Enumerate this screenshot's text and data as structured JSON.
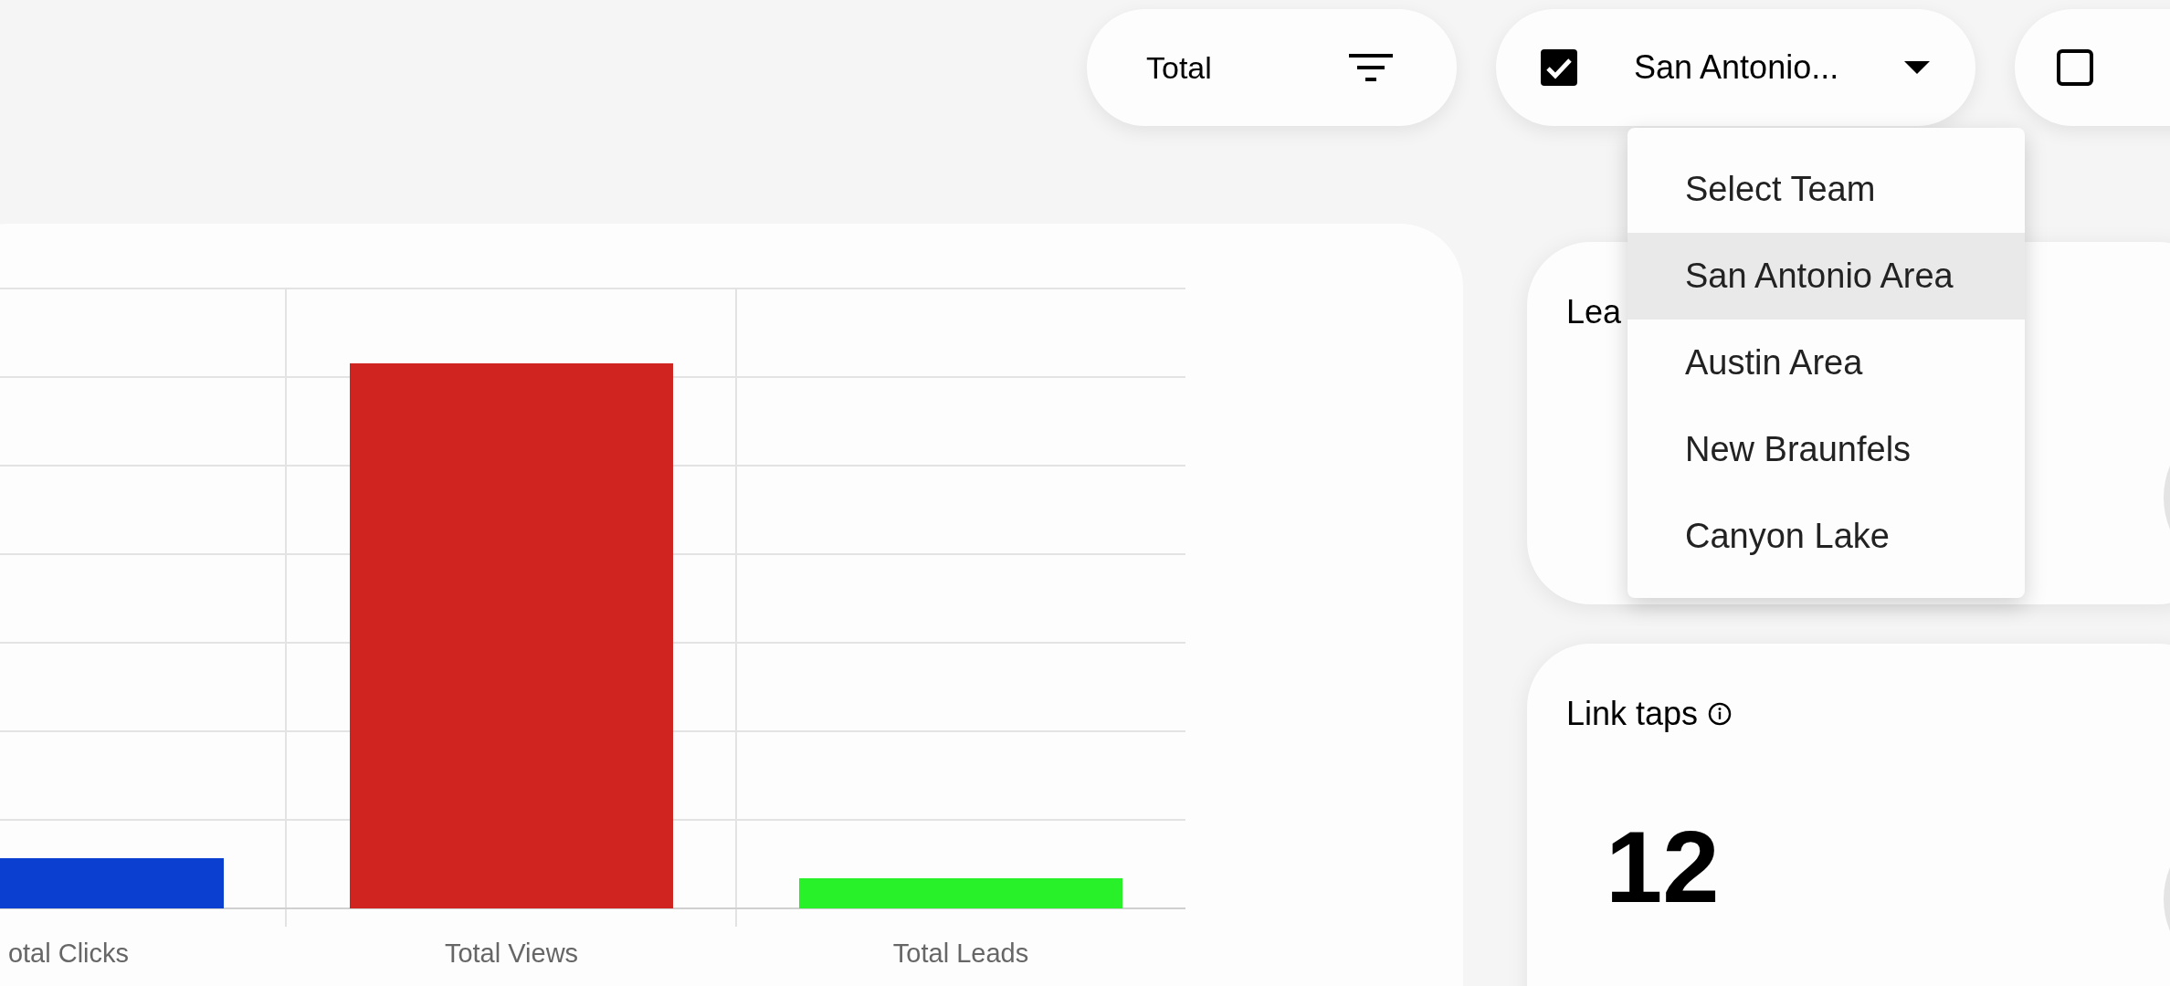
{
  "toolbar": {
    "metric_filter": {
      "label": "Total"
    },
    "team_filter": {
      "checked": true,
      "label": "San Antonio..."
    },
    "third_filter": {
      "checked": false
    }
  },
  "team_menu": {
    "items": [
      {
        "label": "Select Team",
        "selected": false
      },
      {
        "label": "San Antonio Area",
        "selected": true
      },
      {
        "label": "Austin Area",
        "selected": false
      },
      {
        "label": "New Braunfels",
        "selected": false
      },
      {
        "label": "Canyon Lake",
        "selected": false
      }
    ]
  },
  "chart": {
    "bars": [
      {
        "label": "otal Clicks",
        "color": "#0b3fd0"
      },
      {
        "label": "Total Views",
        "color": "#cf2420"
      },
      {
        "label": "Total Leads",
        "color": "#28f12a"
      }
    ]
  },
  "cards": [
    {
      "title": "Lea"
    },
    {
      "title": "Link taps",
      "info": true,
      "value": "12"
    }
  ]
}
